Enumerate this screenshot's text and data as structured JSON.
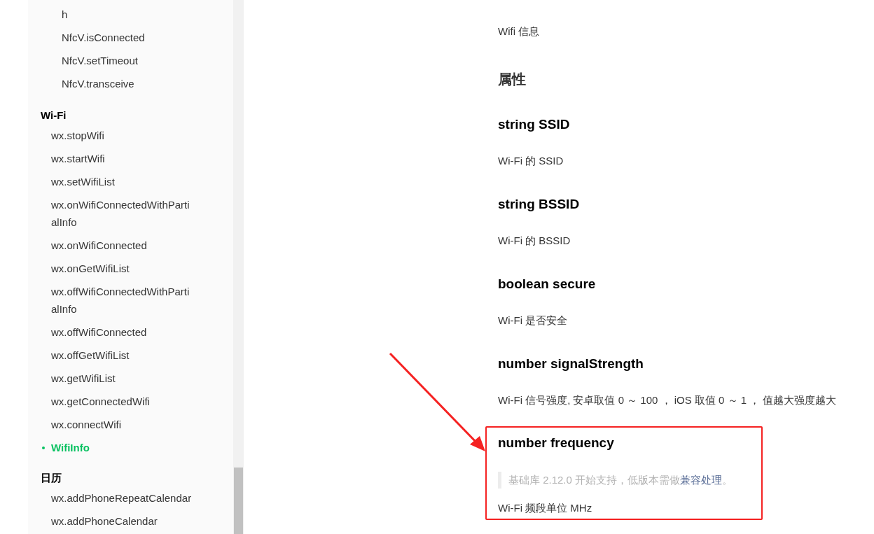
{
  "sidebar": {
    "nested_items": [
      {
        "label": "h",
        "selected": false
      },
      {
        "label": "NfcV.isConnected",
        "selected": false
      },
      {
        "label": "NfcV.setTimeout",
        "selected": false
      },
      {
        "label": "NfcV.transceive",
        "selected": false
      }
    ],
    "sections": [
      {
        "title": "Wi-Fi",
        "items": [
          {
            "label": "wx.stopWifi",
            "selected": false
          },
          {
            "label": "wx.startWifi",
            "selected": false
          },
          {
            "label": "wx.setWifiList",
            "selected": false
          },
          {
            "label": "wx.onWifiConnectedWithPartialInfo",
            "selected": false
          },
          {
            "label": "wx.onWifiConnected",
            "selected": false
          },
          {
            "label": "wx.onGetWifiList",
            "selected": false
          },
          {
            "label": "wx.offWifiConnectedWithPartialInfo",
            "selected": false
          },
          {
            "label": "wx.offWifiConnected",
            "selected": false
          },
          {
            "label": "wx.offGetWifiList",
            "selected": false
          },
          {
            "label": "wx.getWifiList",
            "selected": false
          },
          {
            "label": "wx.getConnectedWifi",
            "selected": false
          },
          {
            "label": "wx.connectWifi",
            "selected": false
          },
          {
            "label": "WifiInfo",
            "selected": true
          }
        ]
      },
      {
        "title": "日历",
        "items": [
          {
            "label": "wx.addPhoneRepeatCalendar",
            "selected": false
          },
          {
            "label": "wx.addPhoneCalendar",
            "selected": false
          }
        ]
      }
    ]
  },
  "article": {
    "summary": "Wifi 信息",
    "section_heading": "属性",
    "properties": [
      {
        "name": "string SSID",
        "description": "Wi-Fi 的 SSID",
        "highlighted": false
      },
      {
        "name": "string BSSID",
        "description": "Wi-Fi 的 BSSID",
        "highlighted": false
      },
      {
        "name": "boolean secure",
        "description": "Wi-Fi 是否安全",
        "highlighted": false
      },
      {
        "name": "number signalStrength",
        "description": "Wi-Fi 信号强度, 安卓取值 0 ～ 100 ， iOS 取值 0 ～ 1 ， 值越大强度越大",
        "highlighted": false
      },
      {
        "name": "number frequency",
        "note": {
          "text": "基础库 2.12.0 开始支持，低版本需做",
          "link": "兼容处理",
          "end": "。"
        },
        "description": "Wi-Fi 频段单位 MHz",
        "highlighted": true
      }
    ]
  }
}
